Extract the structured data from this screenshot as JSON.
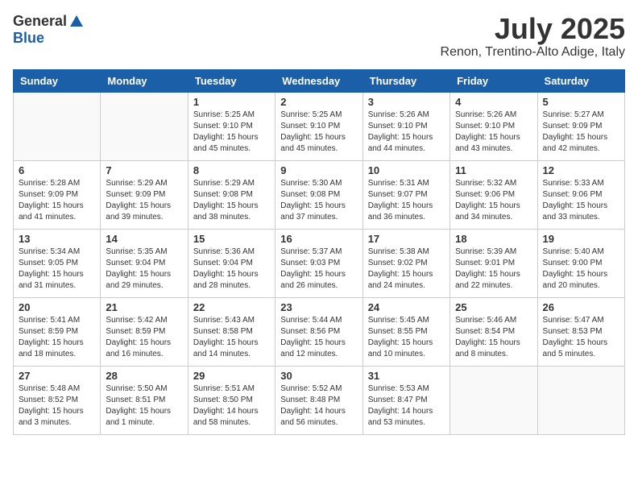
{
  "header": {
    "logo_general": "General",
    "logo_blue": "Blue",
    "month": "July 2025",
    "location": "Renon, Trentino-Alto Adige, Italy"
  },
  "weekdays": [
    "Sunday",
    "Monday",
    "Tuesday",
    "Wednesday",
    "Thursday",
    "Friday",
    "Saturday"
  ],
  "weeks": [
    [
      {
        "day": "",
        "info": ""
      },
      {
        "day": "",
        "info": ""
      },
      {
        "day": "1",
        "info": "Sunrise: 5:25 AM\nSunset: 9:10 PM\nDaylight: 15 hours\nand 45 minutes."
      },
      {
        "day": "2",
        "info": "Sunrise: 5:25 AM\nSunset: 9:10 PM\nDaylight: 15 hours\nand 45 minutes."
      },
      {
        "day": "3",
        "info": "Sunrise: 5:26 AM\nSunset: 9:10 PM\nDaylight: 15 hours\nand 44 minutes."
      },
      {
        "day": "4",
        "info": "Sunrise: 5:26 AM\nSunset: 9:10 PM\nDaylight: 15 hours\nand 43 minutes."
      },
      {
        "day": "5",
        "info": "Sunrise: 5:27 AM\nSunset: 9:09 PM\nDaylight: 15 hours\nand 42 minutes."
      }
    ],
    [
      {
        "day": "6",
        "info": "Sunrise: 5:28 AM\nSunset: 9:09 PM\nDaylight: 15 hours\nand 41 minutes."
      },
      {
        "day": "7",
        "info": "Sunrise: 5:29 AM\nSunset: 9:09 PM\nDaylight: 15 hours\nand 39 minutes."
      },
      {
        "day": "8",
        "info": "Sunrise: 5:29 AM\nSunset: 9:08 PM\nDaylight: 15 hours\nand 38 minutes."
      },
      {
        "day": "9",
        "info": "Sunrise: 5:30 AM\nSunset: 9:08 PM\nDaylight: 15 hours\nand 37 minutes."
      },
      {
        "day": "10",
        "info": "Sunrise: 5:31 AM\nSunset: 9:07 PM\nDaylight: 15 hours\nand 36 minutes."
      },
      {
        "day": "11",
        "info": "Sunrise: 5:32 AM\nSunset: 9:06 PM\nDaylight: 15 hours\nand 34 minutes."
      },
      {
        "day": "12",
        "info": "Sunrise: 5:33 AM\nSunset: 9:06 PM\nDaylight: 15 hours\nand 33 minutes."
      }
    ],
    [
      {
        "day": "13",
        "info": "Sunrise: 5:34 AM\nSunset: 9:05 PM\nDaylight: 15 hours\nand 31 minutes."
      },
      {
        "day": "14",
        "info": "Sunrise: 5:35 AM\nSunset: 9:04 PM\nDaylight: 15 hours\nand 29 minutes."
      },
      {
        "day": "15",
        "info": "Sunrise: 5:36 AM\nSunset: 9:04 PM\nDaylight: 15 hours\nand 28 minutes."
      },
      {
        "day": "16",
        "info": "Sunrise: 5:37 AM\nSunset: 9:03 PM\nDaylight: 15 hours\nand 26 minutes."
      },
      {
        "day": "17",
        "info": "Sunrise: 5:38 AM\nSunset: 9:02 PM\nDaylight: 15 hours\nand 24 minutes."
      },
      {
        "day": "18",
        "info": "Sunrise: 5:39 AM\nSunset: 9:01 PM\nDaylight: 15 hours\nand 22 minutes."
      },
      {
        "day": "19",
        "info": "Sunrise: 5:40 AM\nSunset: 9:00 PM\nDaylight: 15 hours\nand 20 minutes."
      }
    ],
    [
      {
        "day": "20",
        "info": "Sunrise: 5:41 AM\nSunset: 8:59 PM\nDaylight: 15 hours\nand 18 minutes."
      },
      {
        "day": "21",
        "info": "Sunrise: 5:42 AM\nSunset: 8:59 PM\nDaylight: 15 hours\nand 16 minutes."
      },
      {
        "day": "22",
        "info": "Sunrise: 5:43 AM\nSunset: 8:58 PM\nDaylight: 15 hours\nand 14 minutes."
      },
      {
        "day": "23",
        "info": "Sunrise: 5:44 AM\nSunset: 8:56 PM\nDaylight: 15 hours\nand 12 minutes."
      },
      {
        "day": "24",
        "info": "Sunrise: 5:45 AM\nSunset: 8:55 PM\nDaylight: 15 hours\nand 10 minutes."
      },
      {
        "day": "25",
        "info": "Sunrise: 5:46 AM\nSunset: 8:54 PM\nDaylight: 15 hours\nand 8 minutes."
      },
      {
        "day": "26",
        "info": "Sunrise: 5:47 AM\nSunset: 8:53 PM\nDaylight: 15 hours\nand 5 minutes."
      }
    ],
    [
      {
        "day": "27",
        "info": "Sunrise: 5:48 AM\nSunset: 8:52 PM\nDaylight: 15 hours\nand 3 minutes."
      },
      {
        "day": "28",
        "info": "Sunrise: 5:50 AM\nSunset: 8:51 PM\nDaylight: 15 hours\nand 1 minute."
      },
      {
        "day": "29",
        "info": "Sunrise: 5:51 AM\nSunset: 8:50 PM\nDaylight: 14 hours\nand 58 minutes."
      },
      {
        "day": "30",
        "info": "Sunrise: 5:52 AM\nSunset: 8:48 PM\nDaylight: 14 hours\nand 56 minutes."
      },
      {
        "day": "31",
        "info": "Sunrise: 5:53 AM\nSunset: 8:47 PM\nDaylight: 14 hours\nand 53 minutes."
      },
      {
        "day": "",
        "info": ""
      },
      {
        "day": "",
        "info": ""
      }
    ]
  ]
}
